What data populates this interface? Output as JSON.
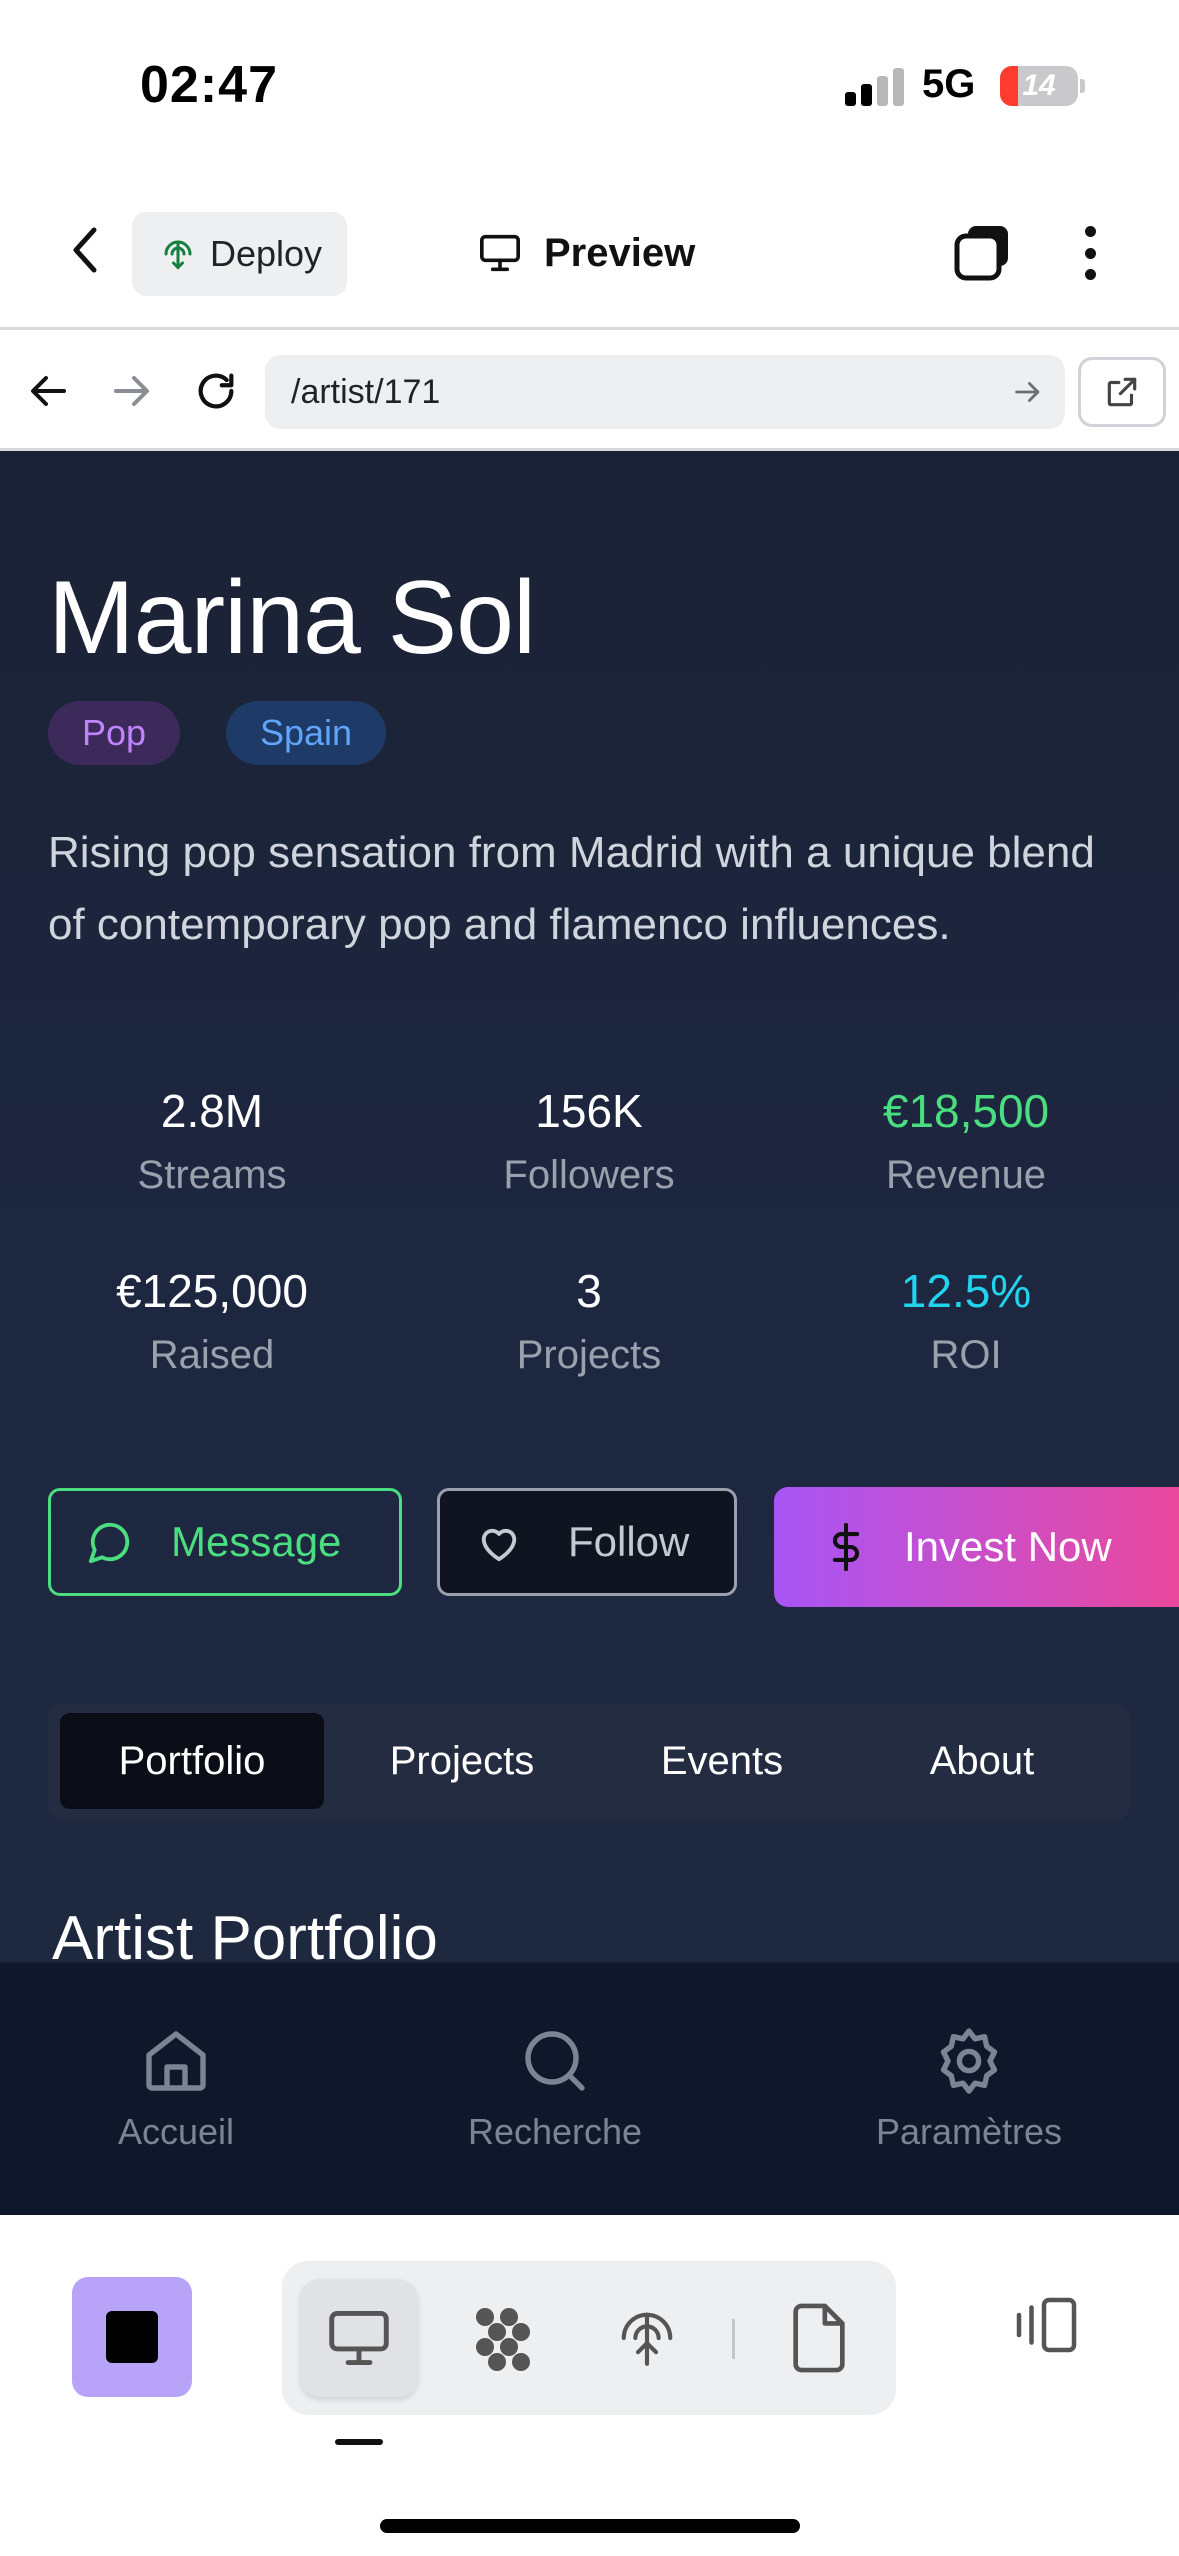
{
  "status_bar": {
    "time": "02:47",
    "network": "5G",
    "battery_level": "14",
    "battery_color": "#ff3b30"
  },
  "header": {
    "deploy_label": "Deploy",
    "preview_label": "Preview"
  },
  "browser": {
    "url": "/artist/171"
  },
  "artist": {
    "name": "Marina Sol",
    "tags": [
      "Pop",
      "Spain"
    ],
    "bio": "Rising pop sensation from Madrid with a unique blend of contemporary pop and flamenco influences.",
    "stats": [
      {
        "value": "2.8M",
        "label": "Streams"
      },
      {
        "value": "156K",
        "label": "Followers"
      },
      {
        "value": "€18,500",
        "label": "Revenue"
      },
      {
        "value": "€125,000",
        "label": "Raised"
      },
      {
        "value": "3",
        "label": "Projects"
      },
      {
        "value": "12.5%",
        "label": "ROI"
      }
    ]
  },
  "actions": {
    "message": "Message",
    "follow": "Follow",
    "invest": "Invest Now"
  },
  "tabs": [
    {
      "label": "Portfolio"
    },
    {
      "label": "Projects"
    },
    {
      "label": "Events"
    },
    {
      "label": "About"
    }
  ],
  "section_title": "Artist Portfolio",
  "bottom_nav": [
    {
      "label": "Accueil",
      "icon": "home-icon"
    },
    {
      "label": "Recherche",
      "icon": "search-icon"
    },
    {
      "label": "Paramètres",
      "icon": "settings-icon"
    }
  ],
  "colors": {
    "accent_green": "#4ade80",
    "accent_cyan": "#22d3ee",
    "invest_gradient_start": "#a855f7",
    "invest_gradient_end": "#ec4899",
    "page_background": "#1b2235"
  }
}
